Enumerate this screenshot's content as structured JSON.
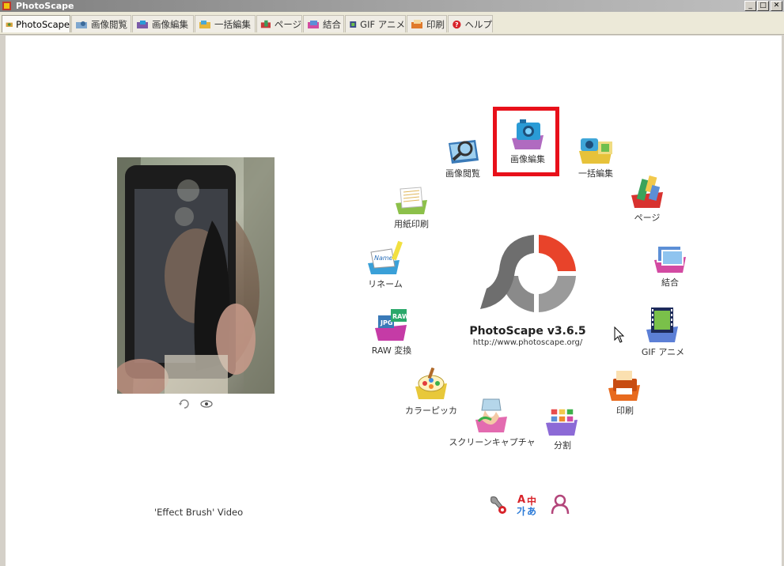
{
  "window": {
    "title": "PhotoScape",
    "min_glyph": "_",
    "max_glyph": "□",
    "close_glyph": "✕"
  },
  "tabs": [
    {
      "label": "PhotoScape",
      "icon": "photoscape-icon",
      "active": true
    },
    {
      "label": "画像閲覧",
      "icon": "viewer-icon"
    },
    {
      "label": "画像編集",
      "icon": "editor-icon"
    },
    {
      "label": "一括編集",
      "icon": "batch-icon"
    },
    {
      "label": "ページ",
      "icon": "page-icon"
    },
    {
      "label": "結合",
      "icon": "combine-icon"
    },
    {
      "label": "GIF アニメ",
      "icon": "gif-icon"
    },
    {
      "label": "印刷",
      "icon": "print-icon"
    },
    {
      "label": "ヘルプ",
      "icon": "help-icon"
    }
  ],
  "menu": {
    "editor": "画像編集",
    "viewer": "画像閲覧",
    "batch": "一括編集",
    "page": "ページ",
    "print_paper": "用紙印刷",
    "combine": "結合",
    "rename": "リネーム",
    "raw": "RAW 変換",
    "gif": "GIF アニメ",
    "color_picker": "カラーピッカ",
    "print": "印刷",
    "screen_capture": "スクリーンキャプチャ",
    "split": "分割"
  },
  "product": {
    "name": "PhotoScape v3.6.5",
    "url": "http://www.photoscape.org/"
  },
  "caption": "'Effect Brush' Video",
  "tools": {
    "lang_glyph_a": "A",
    "lang_glyph_b": "中",
    "lang_glyph_c": "가",
    "lang_glyph_d": "あ"
  },
  "colors": {
    "highlight": "#e8101a",
    "logo_red": "#e8432a",
    "logo_grey": "#8c8c8c"
  }
}
